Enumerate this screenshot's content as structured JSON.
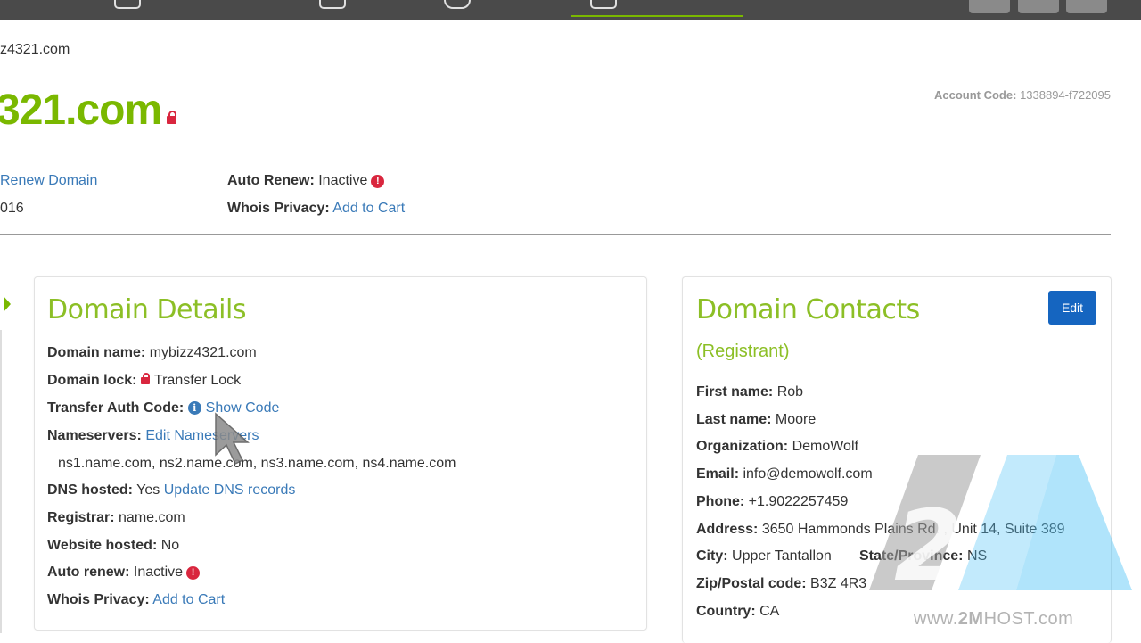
{
  "breadcrumb": "z4321.com",
  "domain_heading": "321.com",
  "account": {
    "label": "Account Code:",
    "value": "1338894-f722095"
  },
  "summary": {
    "renew_link": "Renew Domain",
    "expiry_fragment": "016",
    "auto_renew_label": "Auto Renew:",
    "auto_renew_value": "Inactive",
    "whois_label": "Whois Privacy:",
    "whois_link": "Add to Cart"
  },
  "domain_details": {
    "title": "Domain Details",
    "rows": {
      "name_label": "Domain name:",
      "name_value": "mybizz4321.com",
      "lock_label": "Domain lock:",
      "lock_value": "Transfer Lock",
      "auth_label": "Transfer Auth Code:",
      "auth_link": "Show Code",
      "ns_label": "Nameservers:",
      "ns_link": "Edit Nameservers",
      "ns_list": "ns1.name.com, ns2.name.com, ns3.name.com, ns4.name.com",
      "dns_label": "DNS hosted:",
      "dns_value": "Yes",
      "dns_link": "Update DNS records",
      "registrar_label": "Registrar:",
      "registrar_value": "name.com",
      "website_label": "Website hosted:",
      "website_value": "No",
      "autorenew_label": "Auto renew:",
      "autorenew_value": "Inactive",
      "whois_label": "Whois Privacy:",
      "whois_link": "Add to Cart"
    }
  },
  "domain_contacts": {
    "title": "Domain Contacts",
    "edit_label": "Edit",
    "subtitle": "(Registrant)",
    "rows": {
      "first_label": "First name:",
      "first_value": "Rob",
      "last_label": "Last name:",
      "last_value": "Moore",
      "org_label": "Organization:",
      "org_value": "DemoWolf",
      "email_label": "Email:",
      "email_value": "info@demowolf.com",
      "phone_label": "Phone:",
      "phone_value": "+1.9022257459",
      "address_label": "Address:",
      "address_value": "3650 Hammonds Plains Rd. , Unit 14, Suite 389",
      "city_label": "City:",
      "city_value": "Upper Tantallon",
      "state_label": "State/Province:",
      "state_value": "NS",
      "zip_label": "Zip/Postal code:",
      "zip_value": "B3Z 4R3",
      "country_label": "Country:",
      "country_value": "CA"
    }
  },
  "watermark": {
    "prefix": "www.",
    "brand": "2M",
    "suffix": "HOST.com"
  },
  "colors": {
    "accent_green": "#7ab800",
    "link_blue": "#3a7ab8",
    "alert_red": "#d9263e",
    "button_blue": "#1565c0",
    "topbar": "#4a4a4a"
  },
  "icons": [
    "lock-icon",
    "alert-icon",
    "info-icon",
    "mouse-cursor-icon"
  ]
}
